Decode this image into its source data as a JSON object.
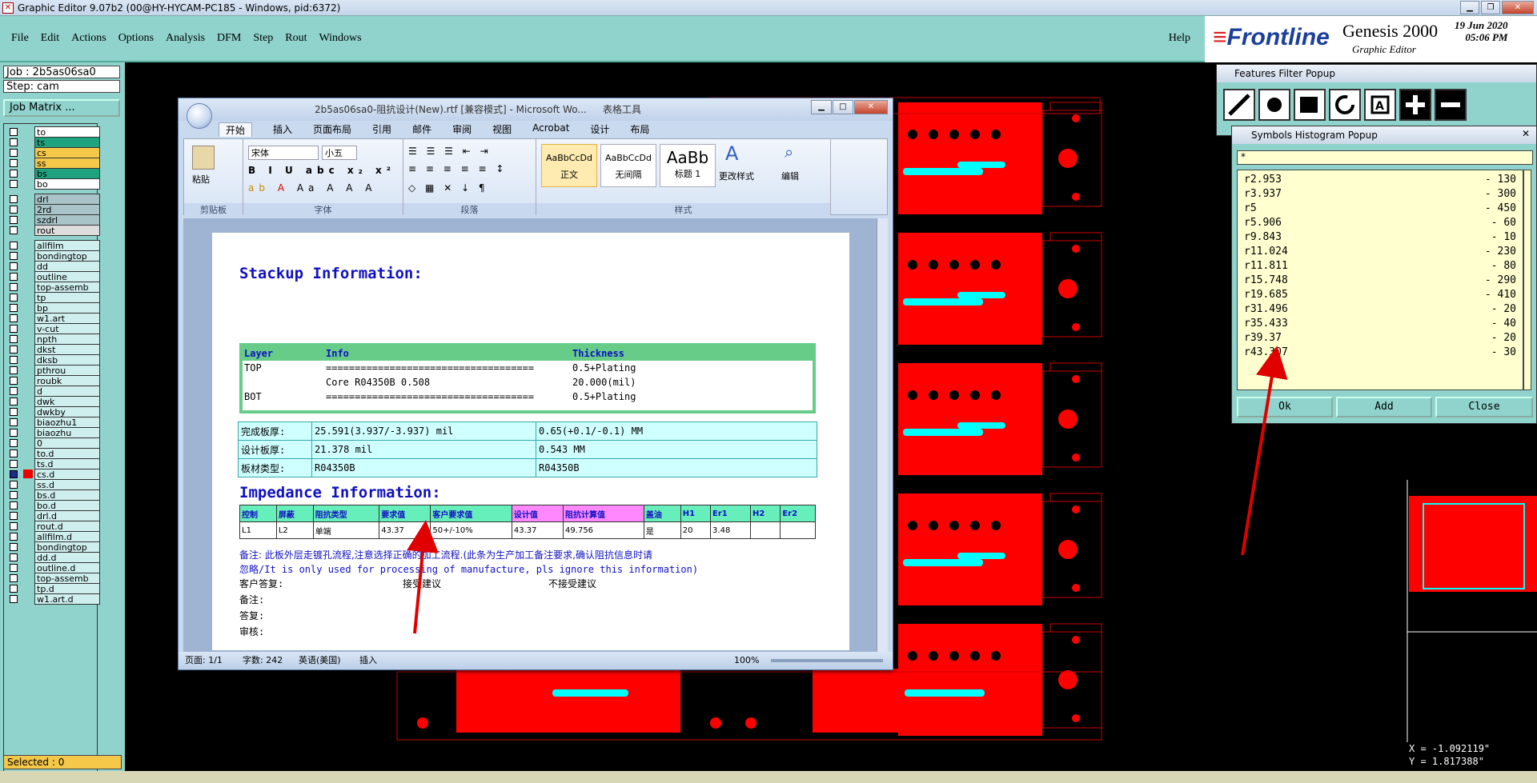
{
  "window": {
    "title": "Graphic Editor 9.07b2 (00@HY-HYCAM-PC185 - Windows, pid:6372)"
  },
  "menu": [
    "File",
    "Edit",
    "Actions",
    "Options",
    "Analysis",
    "DFM",
    "Step",
    "Rout",
    "Windows"
  ],
  "help_label": "Help",
  "brand": {
    "logo": "Frontline",
    "product": "Genesis 2000",
    "subtitle": "Graphic Editor",
    "date": "19 Jun 2020",
    "time": "05:06 PM"
  },
  "left_panel": {
    "job": "Job : 2b5as06sa0",
    "step": "Step: cam",
    "job_matrix_button": "Job Matrix ...",
    "selected": "Selected : 0",
    "layers": [
      {
        "name": "to",
        "color": "#ffffff"
      },
      {
        "name": "ts",
        "color": "#1fa27e"
      },
      {
        "name": "cs",
        "color": "#f5c84a"
      },
      {
        "name": "ss",
        "color": "#f5c84a"
      },
      {
        "name": "bs",
        "color": "#1fa27e"
      },
      {
        "name": "bo",
        "color": "#ffffff"
      },
      {
        "name": "drl",
        "color": "#a8c4c8"
      },
      {
        "name": "2rd",
        "color": "#a8c4c8"
      },
      {
        "name": "szdrl",
        "color": "#a8c4c8"
      },
      {
        "name": "rout",
        "color": "#dddddd"
      },
      {
        "name": "allfilm",
        "color": "#cfeeee"
      },
      {
        "name": "bondingtop",
        "color": "#cfeeee"
      },
      {
        "name": "dd",
        "color": "#cfeeee"
      },
      {
        "name": "outline",
        "color": "#cfeeee"
      },
      {
        "name": "top-assemb",
        "color": "#cfeeee"
      },
      {
        "name": "tp",
        "color": "#cfeeee"
      },
      {
        "name": "bp",
        "color": "#cfeeee"
      },
      {
        "name": "w1.art",
        "color": "#cfeeee"
      },
      {
        "name": "v-cut",
        "color": "#cfeeee"
      },
      {
        "name": "npth",
        "color": "#cfeeee"
      },
      {
        "name": "dkst",
        "color": "#cfeeee"
      },
      {
        "name": "dksb",
        "color": "#cfeeee"
      },
      {
        "name": "pthrou",
        "color": "#cfeeee"
      },
      {
        "name": "roubk",
        "color": "#cfeeee"
      },
      {
        "name": "d",
        "color": "#cfeeee"
      },
      {
        "name": "dwk",
        "color": "#cfeeee"
      },
      {
        "name": "dwkby",
        "color": "#cfeeee"
      },
      {
        "name": "biaozhu1",
        "color": "#cfeeee"
      },
      {
        "name": "biaozhu",
        "color": "#cfeeee"
      },
      {
        "name": "0",
        "color": "#cfeeee"
      },
      {
        "name": "to.d",
        "color": "#cfeeee"
      },
      {
        "name": "ts.d",
        "color": "#cfeeee"
      },
      {
        "name": "cs.d",
        "color": "#cfeeee"
      },
      {
        "name": "ss.d",
        "color": "#cfeeee"
      },
      {
        "name": "bs.d",
        "color": "#cfeeee"
      },
      {
        "name": "bo.d",
        "color": "#cfeeee"
      },
      {
        "name": "drl.d",
        "color": "#cfeeee"
      },
      {
        "name": "rout.d",
        "color": "#cfeeee"
      },
      {
        "name": "allfilm.d",
        "color": "#cfeeee"
      },
      {
        "name": "bondingtop",
        "color": "#cfeeee"
      },
      {
        "name": "dd.d",
        "color": "#cfeeee"
      },
      {
        "name": "outline.d",
        "color": "#cfeeee"
      },
      {
        "name": "top-assemb",
        "color": "#cfeeee"
      },
      {
        "name": "tp.d",
        "color": "#cfeeee"
      },
      {
        "name": "w1.art.d",
        "color": "#cfeeee"
      }
    ]
  },
  "word": {
    "title": "2b5as06sa0-阻抗设计(New).rtf [兼容模式] - Microsoft Wo...",
    "context_tab": "表格工具",
    "tabs": [
      "开始",
      "插入",
      "页面布局",
      "引用",
      "邮件",
      "审阅",
      "视图",
      "Acrobat",
      "设计",
      "布局"
    ],
    "groups": [
      "剪贴板",
      "字体",
      "段落",
      "样式",
      "编辑"
    ],
    "paste_label": "粘贴",
    "font_name": "宋体",
    "font_size": "小五",
    "styles": [
      {
        "sample": "AaBbCcDd",
        "name": "正文"
      },
      {
        "sample": "AaBbCcDd",
        "name": "无间隔"
      },
      {
        "sample": "AaBb",
        "name": "标题 1"
      }
    ],
    "change_styles": "更改样式",
    "edit_label": "编辑",
    "status": {
      "page": "页面: 1/1",
      "words": "字数: 242",
      "lang": "英语(美国)",
      "mode": "插入",
      "zoom": "100%"
    },
    "doc": {
      "stackup_title": "Stackup Information:",
      "stackup_head": [
        "Layer",
        "Info",
        "Thickness"
      ],
      "stackup_rows": [
        [
          "TOP",
          "====================================",
          "0.5+Plating"
        ],
        [
          "",
          "Core     R04350B    0.508",
          "20.000(mil)"
        ],
        [
          "BOT",
          "====================================",
          "0.5+Plating"
        ]
      ],
      "board_rows": [
        [
          "完成板厚:",
          "25.591(3.937/-3.937) mil",
          "0.65(+0.1/-0.1) MM"
        ],
        [
          "设计板厚:",
          "21.378 mil",
          "0.543 MM"
        ],
        [
          "板材类型:",
          "R04350B",
          "R04350B"
        ]
      ],
      "impedance_title": "Impedance Information:",
      "imp_head": [
        "控制",
        "屏蔽",
        "阻抗类型",
        "要求值",
        "客户要求值",
        "设计值",
        "阻抗计算值",
        "盖油",
        "H1",
        "Er1",
        "H2",
        "Er2"
      ],
      "imp_row": [
        "L1",
        "L2",
        "单端",
        "43.37",
        "50+/-10%",
        "43.37",
        "49.756",
        "是",
        "20",
        "3.48",
        "",
        ""
      ],
      "note1": "备注: 此板外层走镀孔流程,注意选择正确的加工流程.(此条为生产加工备注要求,确认阻抗信息时请",
      "note2": "忽略/It is only used for processing of manufacture, pls ignore this information)",
      "reply_label": "客户答复:",
      "accept": "接受建议",
      "reject": "不接受建议",
      "remark": "备注:",
      "answer": "答复:",
      "audit": "审核:"
    }
  },
  "features_filter": {
    "title": "Features Filter Popup"
  },
  "histogram": {
    "title": "Symbols Histogram Popup",
    "filter": "*",
    "rows": [
      {
        "sym": "r2.953",
        "count": "- 130"
      },
      {
        "sym": "r3.937",
        "count": "- 300"
      },
      {
        "sym": "r5",
        "count": "- 450"
      },
      {
        "sym": "r5.906",
        "count": "- 60"
      },
      {
        "sym": "r9.843",
        "count": "- 10"
      },
      {
        "sym": "r11.024",
        "count": "- 230"
      },
      {
        "sym": "r11.811",
        "count": "- 80"
      },
      {
        "sym": "r15.748",
        "count": "- 290"
      },
      {
        "sym": "r19.685",
        "count": "- 410"
      },
      {
        "sym": "r31.496",
        "count": "- 20"
      },
      {
        "sym": "r35.433",
        "count": "- 40"
      },
      {
        "sym": "r39.37",
        "count": "- 20"
      },
      {
        "sym": "r43.307",
        "count": "- 30"
      }
    ],
    "ok": "Ok",
    "add": "Add",
    "close": "Close"
  },
  "coords": {
    "x": "X = -1.092119\"",
    "y": "Y = 1.817388\""
  },
  "colors": {
    "panel": "#8fd3cc",
    "copper": "#ff0000",
    "highlight": "#00ffff",
    "arrow": "#e00000"
  }
}
